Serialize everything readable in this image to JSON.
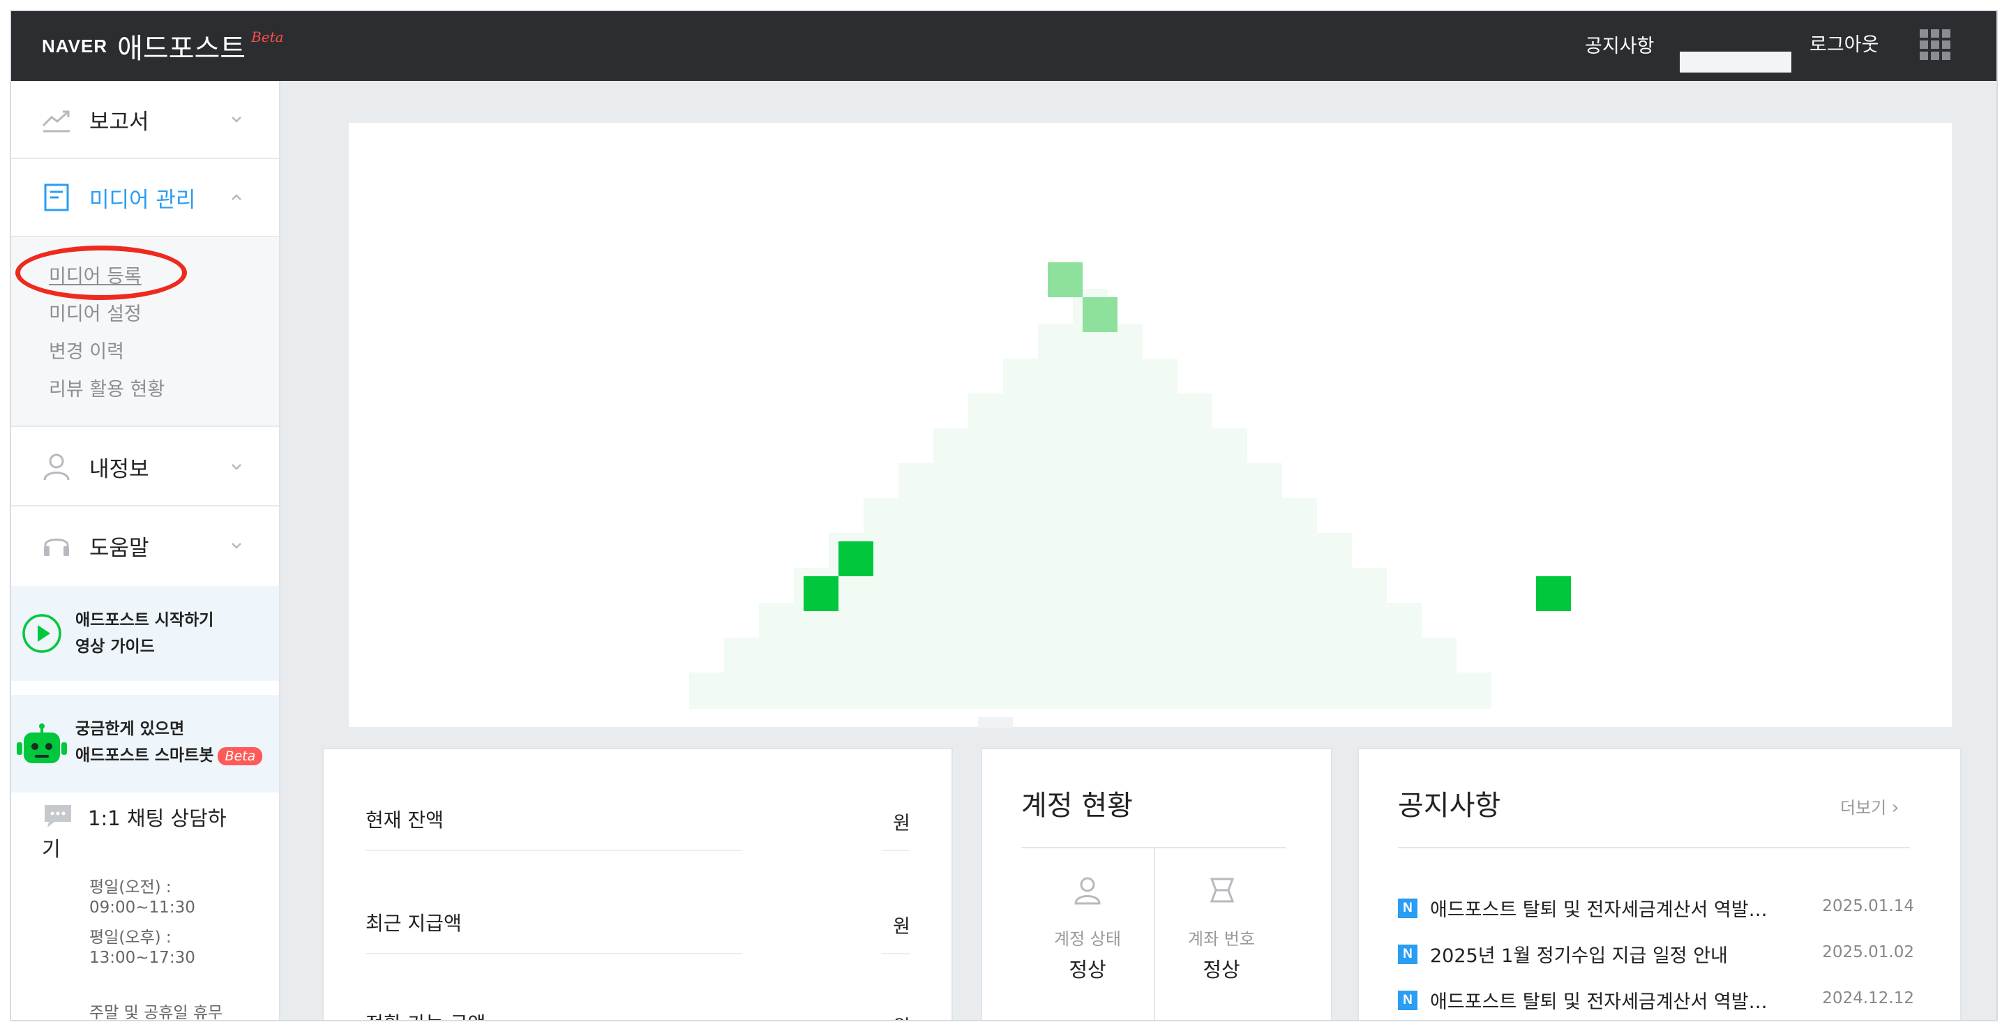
{
  "header": {
    "brand_naver": "NAVER",
    "brand_name": "애드포스트",
    "brand_beta": "Beta",
    "notice_link": "공지사항",
    "logout": "로그아웃"
  },
  "sidebar": {
    "reports": "보고서",
    "media_mgmt": "미디어 관리",
    "submenu": [
      "미디어 등록",
      "미디어 설정",
      "변경 이력",
      "리뷰 활용 현황"
    ],
    "my_info": "내정보",
    "help": "도움말",
    "promo_video": [
      "애드포스트 시작하기",
      "영상 가이드"
    ],
    "promo_bot": [
      "궁금한게 있으면",
      "애드포스트 스마트봇"
    ],
    "promo_bot_beta": "Beta",
    "chat_title_1": "1:1 채팅 상담하",
    "chat_title_2": "기",
    "chat_lines": [
      "평일(오전) :",
      "09:00~11:30",
      "평일(오후) :",
      "13:00~17:30",
      "주말 및 공휴일 휴무"
    ]
  },
  "balance": {
    "rows": [
      {
        "label": "현재 잔액",
        "unit": "원"
      },
      {
        "label": "최근 지급액",
        "unit": "원"
      },
      {
        "label": "전환 가능 금액",
        "unit": "원"
      }
    ]
  },
  "account": {
    "title": "계정 현황",
    "status_label": "계정 상태",
    "status_value": "정상",
    "bank_label": "계좌 번호",
    "bank_value": "정상"
  },
  "notices": {
    "title": "공지사항",
    "more": "더보기",
    "badge": "N",
    "items": [
      {
        "text": "애드포스트 탈퇴 및 전자세금계산서 역발…",
        "date": "2025.01.14"
      },
      {
        "text": "2025년 1월 정기수입 지급 일정 안내",
        "date": "2025.01.02"
      },
      {
        "text": "애드포스트 탈퇴 및 전자세금계산서 역발…",
        "date": "2024.12.12"
      }
    ]
  },
  "colors": {
    "topbar": "#2b2d30",
    "accent_blue": "#2a9df4",
    "pixel_light": "#f1faf3",
    "pixel_green": "#00c73c",
    "pixel_green_light": "#8ee09d",
    "annotation_red": "#ee2a1f"
  },
  "icons": {
    "reports": "chart-line-icon",
    "media": "document-icon",
    "my_info": "person-icon",
    "help": "headset-icon",
    "video": "play-circle-icon",
    "bot": "robot-icon",
    "chat": "chat-bubble-icon",
    "apps": "apps-grid-icon"
  }
}
